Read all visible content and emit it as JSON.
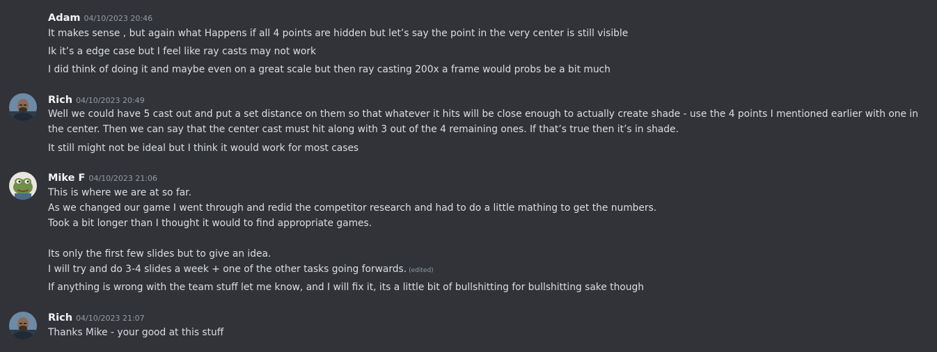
{
  "messages": [
    {
      "author": "Adam",
      "timestamp": "04/10/2023 20:46",
      "lines": [
        "It makes sense , but again what Happens if all 4 points are hidden but let’s say the point in the very center is still visible",
        "Ik it’s a edge case but I feel like ray casts may not work",
        "I did think of doing it and maybe even on a great scale but then ray casting 200x a frame would probs be a bit much"
      ]
    },
    {
      "author": "Rich",
      "timestamp": "04/10/2023 20:49",
      "lines": [
        "Well we could have 5 cast out and put a set distance on them so that whatever it hits will be close enough to actually create shade - use the 4 points I mentioned earlier with one in the center. Then we can say that the center cast must hit along with 3 out of the 4 remaining ones. If that’s true then it’s in shade.",
        "It still might not be ideal but I think it would work for most cases"
      ]
    },
    {
      "author": "Mike F",
      "timestamp": "04/10/2023 21:06",
      "lines": [
        "This is where we are at so far.",
        "As we changed our game I went through and redid the competitor research and had to do a little mathing to get the numbers.",
        "Took a bit longer than I thought it would to find appropriate games.",
        "Its only the first few slides but to give an idea.",
        "I will try and do 3-4 slides a week + one of the other tasks going forwards.",
        "If anything is wrong with the team stuff let me know, and I will fix it, its a little bit of bullshitting for bullshitting sake though"
      ],
      "edited_label": "(edited)"
    },
    {
      "author": "Rich",
      "timestamp": "04/10/2023 21:07",
      "lines": [
        "Thanks Mike - your good at this stuff"
      ]
    }
  ],
  "colors": {
    "background": "#313338",
    "text": "#dbdee1",
    "author": "#f2f3f5",
    "muted": "#949ba4"
  },
  "icons": {
    "rich_avatar": "person-photo-avatar",
    "mike_avatar": "frog-avatar"
  }
}
